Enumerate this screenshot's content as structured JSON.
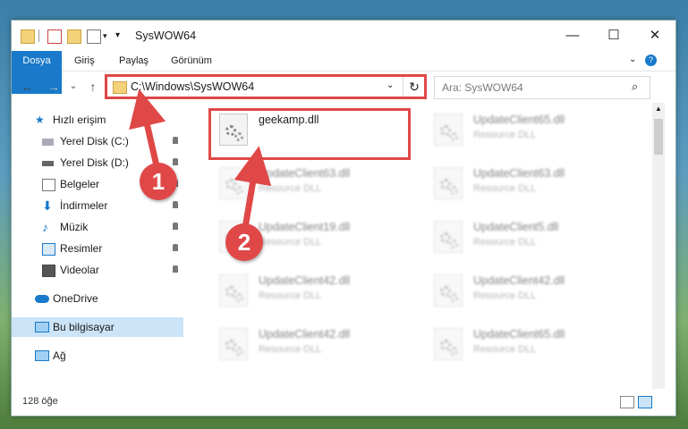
{
  "window": {
    "title": "SysWOW64"
  },
  "ribbon": {
    "tabs": [
      "Dosya",
      "Giriş",
      "Paylaş",
      "Görünüm"
    ]
  },
  "address": {
    "path": "C:\\Windows\\SysWOW64"
  },
  "search": {
    "placeholder": "Ara: SysWOW64"
  },
  "nav": {
    "items": [
      {
        "label": "Hızlı erişim"
      },
      {
        "label": "Yerel Disk (C:)"
      },
      {
        "label": "Yerel Disk (D:)"
      },
      {
        "label": "Belgeler"
      },
      {
        "label": "İndirmeler"
      },
      {
        "label": "Müzik"
      },
      {
        "label": "Resimler"
      },
      {
        "label": "Videolar"
      },
      {
        "label": "OneDrive"
      },
      {
        "label": "Bu bilgisayar"
      },
      {
        "label": "Ağ"
      }
    ]
  },
  "files": [
    {
      "name": "geekamp.dll",
      "type": ""
    },
    {
      "name": "UpdateClient65.dll",
      "type": "Resource DLL"
    },
    {
      "name": "UpdateClient63.dll",
      "type": "Resource DLL"
    },
    {
      "name": "UpdateClient63.dll",
      "type": "Resource DLL"
    },
    {
      "name": "UpdateClient19.dll",
      "type": "Resource DLL"
    },
    {
      "name": "UpdateClient5.dll",
      "type": "Resource DLL"
    },
    {
      "name": "UpdateClient42.dll",
      "type": "Resource DLL"
    },
    {
      "name": "UpdateClient42.dll",
      "type": "Resource DLL"
    },
    {
      "name": "UpdateClient42.dll",
      "type": "Resource DLL"
    },
    {
      "name": "UpdateClient65.dll",
      "type": "Resource DLL"
    }
  ],
  "status": {
    "count": "128 öğe"
  },
  "annotations": {
    "step1": "1",
    "step2": "2"
  },
  "colors": {
    "accent": "#1979ca",
    "highlight": "#e04848",
    "selected": "#cce4f7"
  }
}
